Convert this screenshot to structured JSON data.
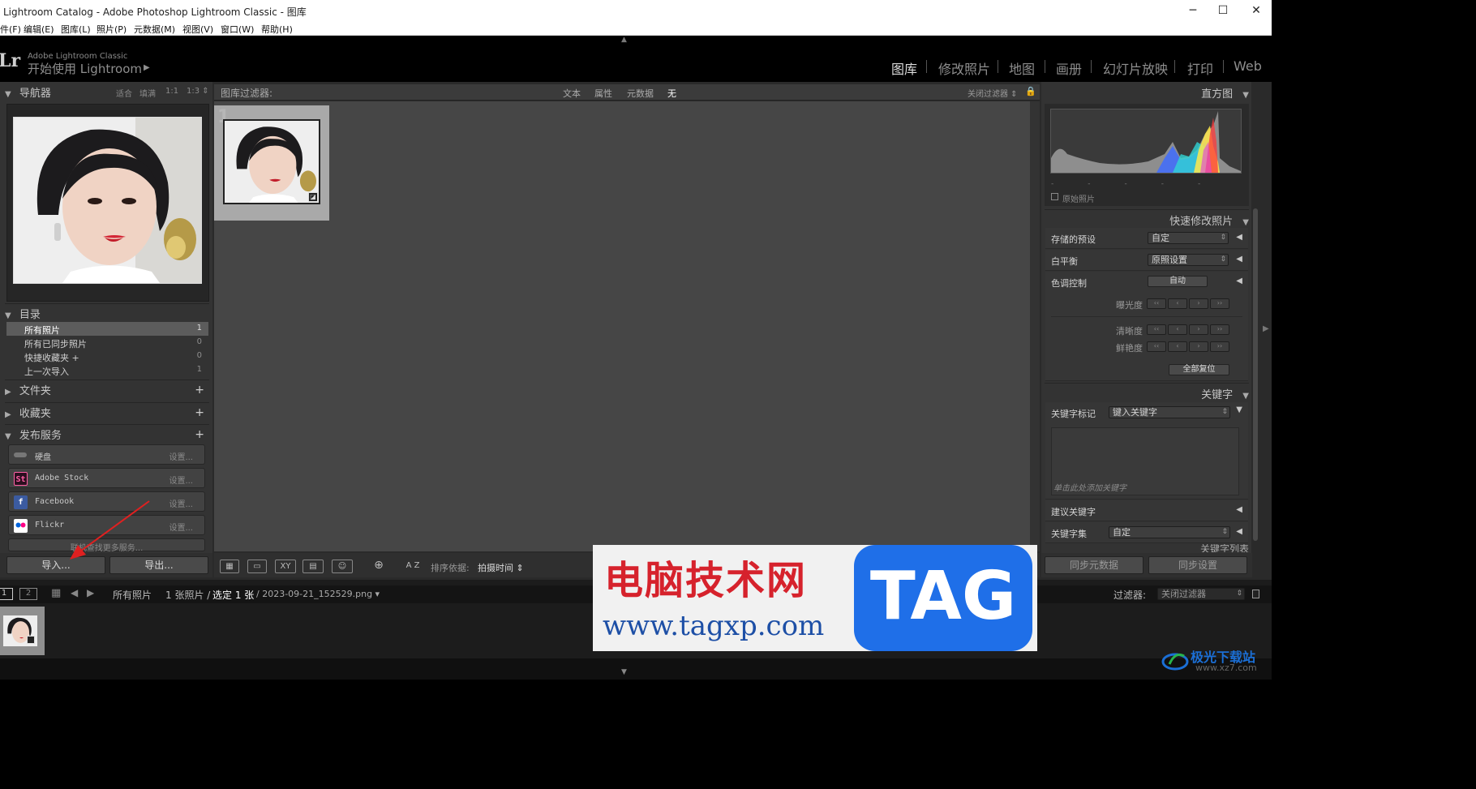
{
  "window": {
    "title": "Lightroom Catalog - Adobe Photoshop Lightroom Classic - 图库",
    "minimize": "─",
    "maximize": "☐",
    "close": "✕"
  },
  "menu": [
    "件(F)",
    "编辑(E)",
    "图库(L)",
    "照片(P)",
    "元数据(M)",
    "视图(V)",
    "窗口(W)",
    "帮助(H)"
  ],
  "identity": {
    "logo": "Lr",
    "brand": "Adobe Lightroom Classic",
    "tagline": "开始使用 Lightroom",
    "arrow": "▶"
  },
  "modules": [
    "图库",
    "修改照片",
    "地图",
    "画册",
    "幻灯片放映",
    "打印",
    "Web"
  ],
  "navigator": {
    "title": "导航器",
    "zoom": [
      "适合",
      "填满",
      "1:1",
      "1:3 ⇕"
    ]
  },
  "catalog": {
    "title": "目录",
    "items": [
      {
        "name": "所有照片",
        "count": "1"
      },
      {
        "name": "所有已同步照片",
        "count": "0"
      },
      {
        "name": "快捷收藏夹 +",
        "count": "0"
      },
      {
        "name": "上一次导入",
        "count": "1"
      }
    ]
  },
  "folders": {
    "title": "文件夹"
  },
  "collections": {
    "title": "收藏夹"
  },
  "publish": {
    "title": "发布服务",
    "services": [
      {
        "name": "硬盘",
        "setup": "设置..."
      },
      {
        "name": "Adobe Stock",
        "setup": "设置..."
      },
      {
        "name": "Facebook",
        "setup": "设置..."
      },
      {
        "name": "Flickr",
        "setup": "设置..."
      }
    ],
    "more": "联机查找更多服务..."
  },
  "import_button": "导入...",
  "export_button": "导出...",
  "filter_bar": {
    "label": "图库过滤器:",
    "tabs": [
      "文本",
      "属性",
      "元数据",
      "无"
    ],
    "close": "关闭过滤器 ⇕"
  },
  "grid": {
    "index": "1"
  },
  "toolbar": {
    "sort_label": "排序依据:",
    "sort_value": "拍摄时间 ⇕",
    "az": "A Z"
  },
  "histogram": {
    "title": "直方图",
    "original": "原始照片"
  },
  "quick_develop": {
    "title": "快速修改照片",
    "saved_preset": {
      "label": "存储的预设",
      "value": "自定"
    },
    "white_balance": {
      "label": "白平衡",
      "value": "原照设置"
    },
    "tone": {
      "label": "色调控制",
      "value": "自动"
    },
    "exposure": "曝光度",
    "clarity": "清晰度",
    "vibrance": "鲜艳度",
    "reset": "全部复位",
    "step_glyphs": [
      "‹‹",
      "‹",
      "›",
      "››"
    ]
  },
  "keywording": {
    "title": "关键字",
    "tags_label": "关键字标记",
    "tags_value": "键入关键字",
    "placeholder": "单击此处添加关键字",
    "suggested": "建议关键字",
    "set_label": "关键字集",
    "set_value": "自定",
    "next": "关键字列表"
  },
  "sync": {
    "metadata": "同步元数据",
    "settings": "同步设置"
  },
  "filmstrip": {
    "page1": "1",
    "page2": "2",
    "source": "所有照片",
    "count": "1 张照片 /",
    "selected": "选定 1 张",
    "filename": "/ 2023-09-21_152529.png ▾",
    "filter_label": "过滤器:",
    "filter_value": "关闭过滤器"
  },
  "watermark": {
    "cn": "电脑技术网",
    "url": "www.tagxp.com",
    "tag": "TAG",
    "site_name": "极光下载站",
    "site_url": "www.xz7.com"
  }
}
